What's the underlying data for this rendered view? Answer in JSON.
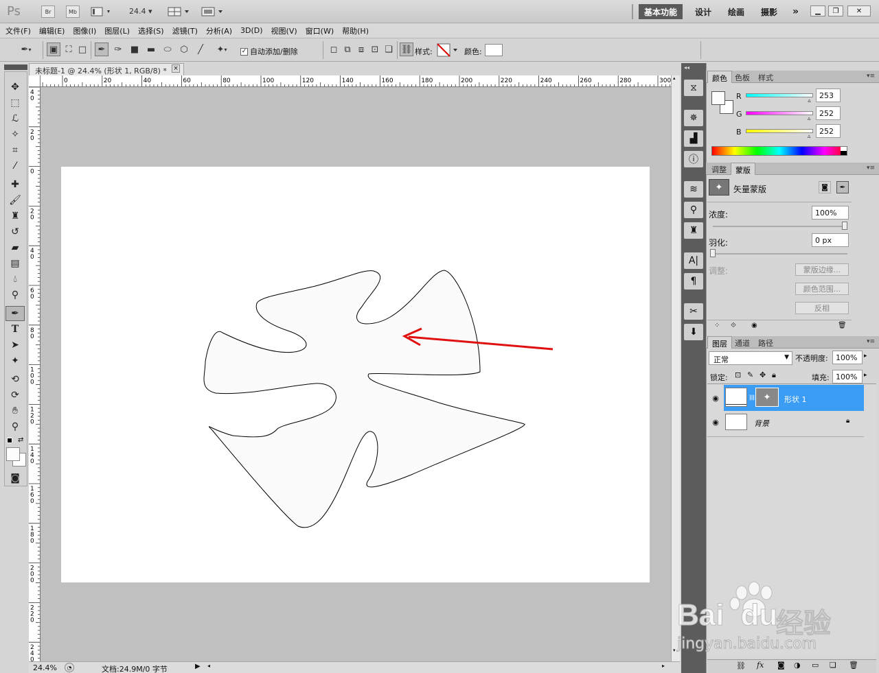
{
  "app": {
    "logo": "Ps",
    "bridge_label": "Br",
    "minibridge_label": "Mb",
    "zoom": "24.4",
    "workspaces": [
      "基本功能",
      "设计",
      "绘画",
      "摄影"
    ],
    "more": "»"
  },
  "menu": [
    "文件(F)",
    "编辑(E)",
    "图像(I)",
    "图层(L)",
    "选择(S)",
    "滤镜(T)",
    "分析(A)",
    "3D(D)",
    "视图(V)",
    "窗口(W)",
    "帮助(H)"
  ],
  "options": {
    "auto_add_delete_label": "自动添加/删除",
    "style_label": "样式:",
    "color_label": "颜色:"
  },
  "document": {
    "tab_title": "未标题-1 @ 24.4% (形状 1, RGB/8) *",
    "close": "×",
    "ruler_top": [
      "0",
      "20",
      "40",
      "60",
      "80",
      "100",
      "120",
      "140",
      "160",
      "180",
      "200",
      "220",
      "240",
      "260",
      "280",
      "300"
    ],
    "ruler_left": [
      "4\n0",
      "2\n0",
      "0",
      "2\n0",
      "4\n0",
      "6\n0",
      "8\n0",
      "1\n0\n0",
      "1\n2\n0",
      "1\n4\n0",
      "1\n6\n0",
      "1\n8\n0",
      "2\n0\n0",
      "2\n2\n0",
      "2\n4\n0"
    ]
  },
  "status": {
    "zoom": "24.4%",
    "doc_info": "文档:24.9M/0 字节"
  },
  "color_panel": {
    "tabs": [
      "颜色",
      "色板",
      "样式"
    ],
    "r_label": "R",
    "g_label": "G",
    "b_label": "B",
    "r_value": "253",
    "g_value": "252",
    "b_value": "252",
    "r": 253,
    "g": 252,
    "b": 252
  },
  "masks_panel": {
    "tabs": [
      "调整",
      "蒙版"
    ],
    "vector_mask_label": "矢量蒙版",
    "density_label": "浓度:",
    "density_value": "100%",
    "density": 100,
    "feather_label": "羽化:",
    "feather_value": "0 px",
    "feather": 0,
    "refine_label": "调整:",
    "btn_mask_edge": "蒙版边缘...",
    "btn_color_range": "颜色范围...",
    "btn_invert": "反相"
  },
  "layers_panel": {
    "tabs": [
      "图层",
      "通道",
      "路径"
    ],
    "blend_mode": "正常",
    "opacity_label": "不透明度:",
    "opacity_value": "100%",
    "lock_label": "锁定:",
    "fill_label": "填充:",
    "fill_value": "100%",
    "layers": [
      {
        "name": "形状 1",
        "selected": true
      },
      {
        "name": "背景",
        "selected": false
      }
    ]
  },
  "watermark": {
    "brand": "Bai",
    "brand2": "du",
    "brand_cn": "经验",
    "url": "jingyan.baidu.com"
  },
  "colors": {
    "accent_selected": "#3b9cf4",
    "arrow": "#e01010"
  }
}
